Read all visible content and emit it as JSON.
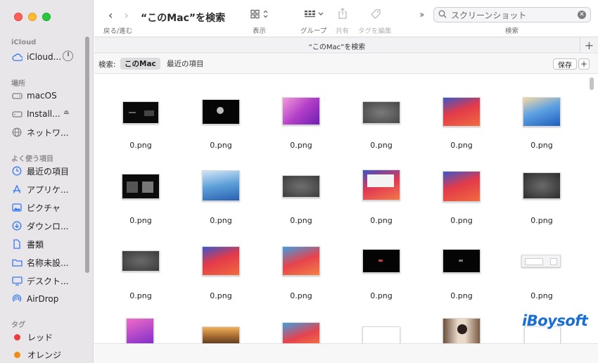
{
  "window": {
    "title": "“このMac”を検索",
    "tab_title": "“このMac”を検索"
  },
  "toolbar": {
    "nav_caption": "戻る/進む",
    "view_caption": "表示",
    "group_caption": "グループ",
    "share_caption": "共有",
    "tags_caption": "タグを編集",
    "search_caption": "検索",
    "search_value": "スクリーンショット"
  },
  "sidebar": {
    "sections": {
      "icloud": "iCloud",
      "locations": "場所",
      "favorites": "よく使う項目",
      "tags": "タグ"
    },
    "icloud_items": [
      {
        "label": "iCloud...",
        "icon": "cloud-icon"
      }
    ],
    "location_items": [
      {
        "label": "macOS",
        "icon": "drive-icon"
      },
      {
        "label": "Install...",
        "icon": "external-drive-icon"
      },
      {
        "label": "ネットワ...",
        "icon": "network-globe-icon"
      }
    ],
    "favorite_items": [
      {
        "label": "最近の項目",
        "icon": "clock-icon"
      },
      {
        "label": "アプリケ...",
        "icon": "applications-icon"
      },
      {
        "label": "ピクチャ",
        "icon": "photo-icon"
      },
      {
        "label": "ダウンロ...",
        "icon": "download-icon"
      },
      {
        "label": "書類",
        "icon": "document-icon"
      },
      {
        "label": "名称未設...",
        "icon": "folder-icon"
      },
      {
        "label": "デスクト...",
        "icon": "desktop-icon"
      },
      {
        "label": "AirDrop",
        "icon": "airdrop-icon"
      }
    ],
    "tag_items": [
      {
        "label": "レッド",
        "color": "#ec3b3b"
      },
      {
        "label": "オレンジ",
        "color": "#f08a17"
      }
    ]
  },
  "scope": {
    "label": "検索:",
    "this_mac": "このMac",
    "recent": "最近の項目",
    "save": "保存",
    "add": "+"
  },
  "files": {
    "rows": [
      [
        "0.png",
        "0.png",
        "0.png",
        "0.png",
        "0.png",
        "0.png"
      ],
      [
        "0.png",
        "0.png",
        "0.png",
        "0.png",
        "0.png",
        "0.png"
      ],
      [
        "0.png",
        "0.png",
        "0.png",
        "0.png",
        "0.png",
        "0.png"
      ]
    ]
  },
  "watermark": "iBoysoft"
}
